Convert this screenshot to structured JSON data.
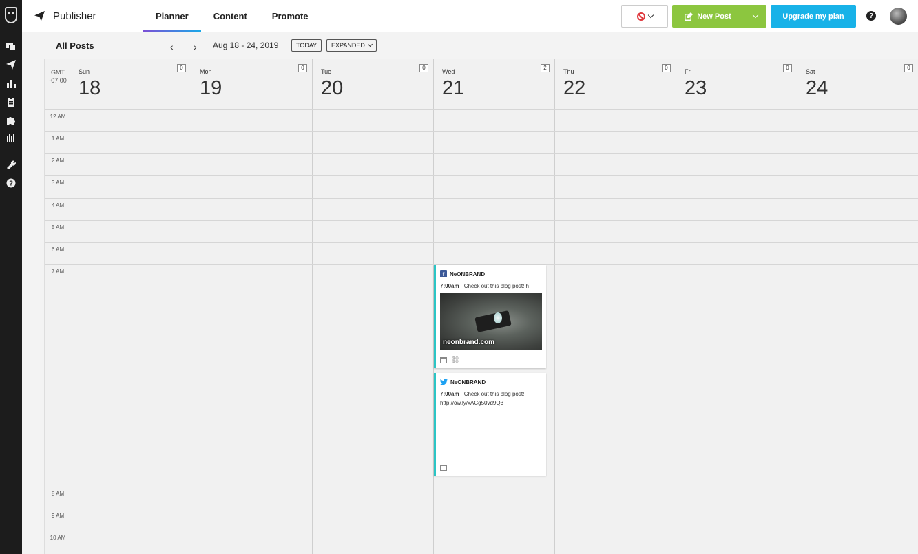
{
  "app": {
    "name": "Publisher"
  },
  "nav": {
    "tabs": [
      {
        "label": "Planner",
        "active": true
      },
      {
        "label": "Content",
        "active": false
      },
      {
        "label": "Promote",
        "active": false
      }
    ]
  },
  "actions": {
    "new_post": "New Post",
    "upgrade": "Upgrade my plan",
    "help": "?"
  },
  "toolbar": {
    "title": "All Posts",
    "date_range": "Aug 18 - 24, 2019",
    "today": "TODAY",
    "view": "EXPANDED"
  },
  "calendar": {
    "timezone_line1": "GMT",
    "timezone_line2": "-07:00",
    "days": [
      {
        "name": "Sun",
        "date": "18",
        "count": "0"
      },
      {
        "name": "Mon",
        "date": "19",
        "count": "0"
      },
      {
        "name": "Tue",
        "date": "20",
        "count": "0"
      },
      {
        "name": "Wed",
        "date": "21",
        "count": "2"
      },
      {
        "name": "Thu",
        "date": "22",
        "count": "0"
      },
      {
        "name": "Fri",
        "date": "23",
        "count": "0"
      },
      {
        "name": "Sat",
        "date": "24",
        "count": "0"
      }
    ],
    "hours": [
      "12 AM",
      "1 AM",
      "2 AM",
      "3 AM",
      "4 AM",
      "5 AM",
      "6 AM",
      "7 AM",
      "8 AM",
      "9 AM",
      "10 AM"
    ]
  },
  "posts": [
    {
      "network": "facebook",
      "account": "NeONBRAND",
      "time": "7:00am",
      "text": " · Check out this blog post! h",
      "image_caption": "neonbrand.com"
    },
    {
      "network": "twitter",
      "account": "NeONBRAND",
      "time": "7:00am",
      "text": " · Check out this blog post! http://ow.ly/xACg50vd9Q3"
    }
  ],
  "colors": {
    "green": "#8cc63f",
    "blue": "#18b2e8",
    "teal": "#2bc5c5",
    "rail": "#1c1c1c"
  }
}
